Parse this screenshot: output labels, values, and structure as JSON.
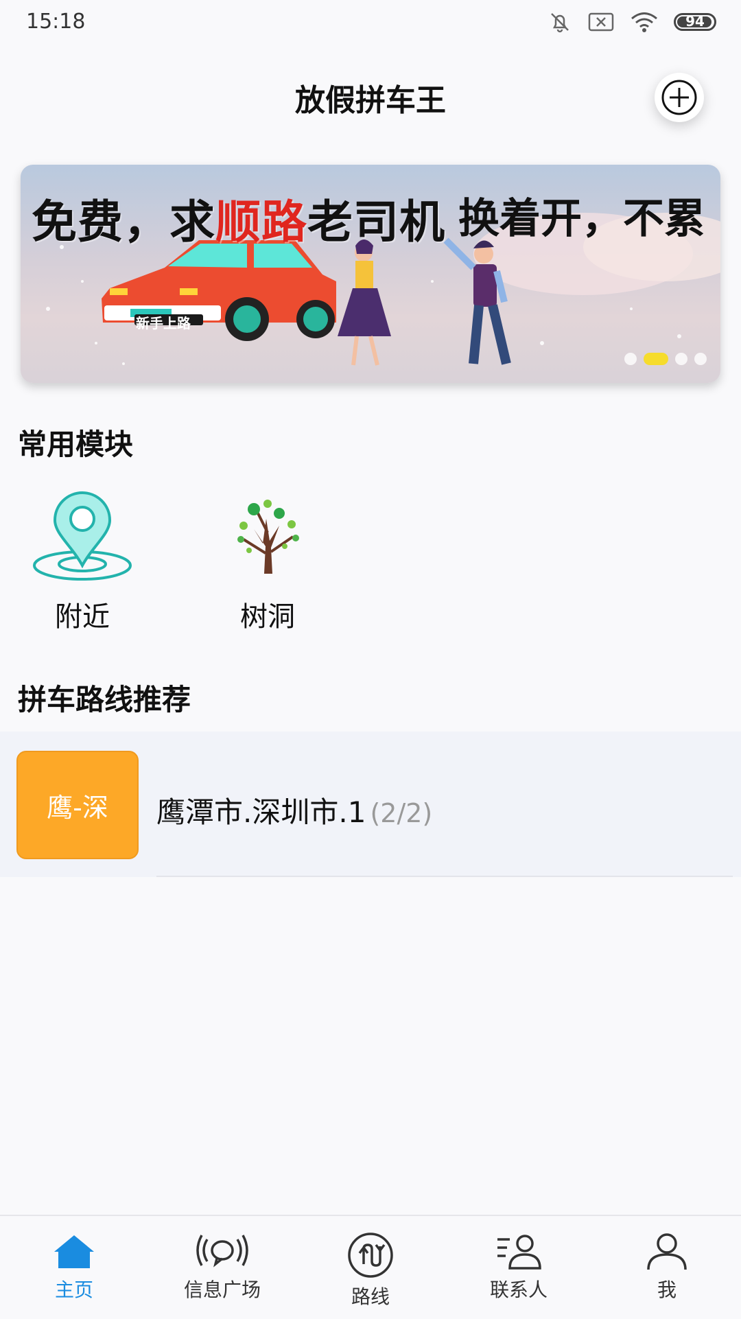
{
  "status": {
    "time": "15:18",
    "battery": "94"
  },
  "header": {
    "title": "放假拼车王"
  },
  "banner": {
    "left_pre": "免费，求",
    "left_highlight": "顺路",
    "left_post": "老司机",
    "right": "换着开，不累",
    "plate_text": "新手上路",
    "highlight_color": "#e0261f"
  },
  "modules": {
    "title": "常用模块",
    "items": [
      {
        "label": "附近",
        "icon": "location-pin-icon"
      },
      {
        "label": "树洞",
        "icon": "tree-icon"
      }
    ]
  },
  "routes": {
    "title": "拼车路线推荐",
    "items": [
      {
        "tag": "鹰-深",
        "name": "鹰潭市.深圳市.1",
        "count": "(2/2)"
      }
    ]
  },
  "nav": {
    "items": [
      {
        "label": "主页",
        "icon": "home-icon",
        "active": true
      },
      {
        "label": "信息广场",
        "icon": "broadcast-icon",
        "active": false
      },
      {
        "label": "路线",
        "icon": "route-icon",
        "active": false
      },
      {
        "label": "联系人",
        "icon": "contacts-icon",
        "active": false
      },
      {
        "label": "我",
        "icon": "profile-icon",
        "active": false
      }
    ],
    "active_color": "#1a8ce0"
  }
}
